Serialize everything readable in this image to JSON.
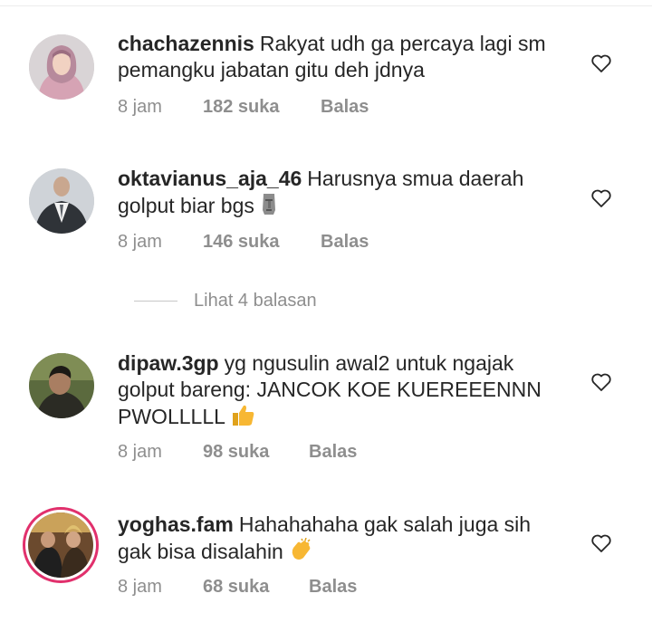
{
  "comments": [
    {
      "username": "chachazennis",
      "text": "Rakyat udh ga percaya lagi sm pemangku jabatan gitu deh jdnya",
      "time": "8 jam",
      "likes": "182 suka",
      "reply": "Balas",
      "avatar_icon": "profile-photo-woman-hijab"
    },
    {
      "username": "oktavianus_aja_46",
      "text": "Harusnya smua daerah golput biar bgs",
      "emoji": "moai-emoji",
      "time": "8 jam",
      "likes": "146 suka",
      "reply": "Balas",
      "avatar_icon": "profile-photo-man-suit"
    },
    {
      "username": "dipaw.3gp",
      "text": "yg ngusulin awal2 untuk ngajak golput bareng: JANCOK KOE KUEREEENNN PWOLLLLL",
      "emoji": "thumbs-up-emoji",
      "time": "8 jam",
      "likes": "98 suka",
      "reply": "Balas",
      "avatar_icon": "profile-photo-man"
    },
    {
      "username": "yoghas.fam",
      "text": "Hahahahaha gak salah juga sih gak bisa disalahin",
      "emoji": "clapping-hands-emoji",
      "time": "8 jam",
      "likes": "68 suka",
      "reply": "Balas",
      "avatar_icon": "profile-photo-couple-wedding",
      "story_ring_color": "#e1306c"
    }
  ],
  "view_replies": "Lihat 4 balasan",
  "colors": {
    "text": "#262626",
    "meta": "#8e8e8e",
    "story_ring": "#e1306c"
  }
}
